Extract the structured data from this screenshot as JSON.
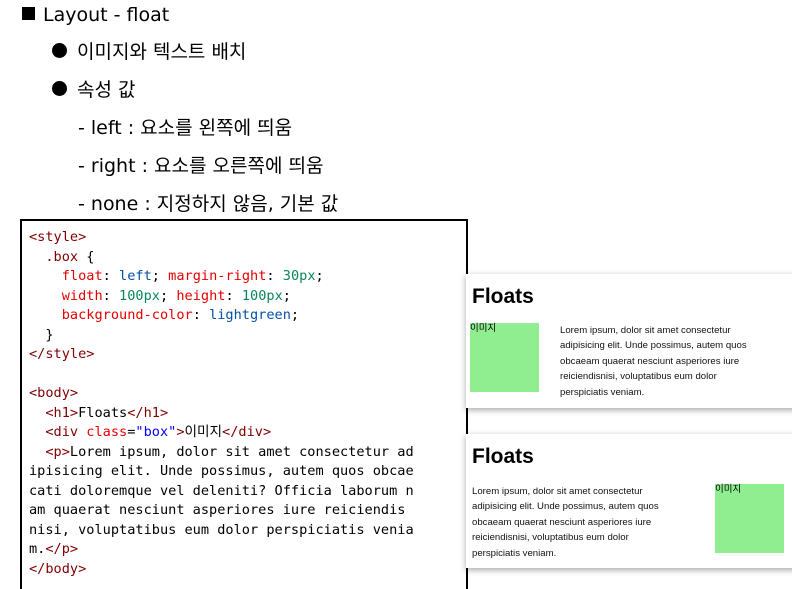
{
  "heading": "Layout - float",
  "bullets": [
    "이미지와 텍스트 배치",
    "속성 값"
  ],
  "values": [
    "- left : 요소를 왼쪽에 띄움",
    "- right : 요소를 오른쪽에 띄움",
    "- none : 지정하지 않음, 기본 값"
  ],
  "code_lines": [
    [
      {
        "c": "tag",
        "t": "<style>"
      }
    ],
    [
      {
        "c": "sel",
        "t": "  .box"
      },
      {
        "c": "txt",
        "t": " {"
      }
    ],
    [
      {
        "c": "prop",
        "t": "    float"
      },
      {
        "c": "txt",
        "t": ": "
      },
      {
        "c": "val",
        "t": "left"
      },
      {
        "c": "txt",
        "t": "; "
      },
      {
        "c": "prop",
        "t": "margin-right"
      },
      {
        "c": "txt",
        "t": ": "
      },
      {
        "c": "num",
        "t": "30px"
      },
      {
        "c": "txt",
        "t": ";"
      }
    ],
    [
      {
        "c": "prop",
        "t": "    width"
      },
      {
        "c": "txt",
        "t": ": "
      },
      {
        "c": "num",
        "t": "100px"
      },
      {
        "c": "txt",
        "t": "; "
      },
      {
        "c": "prop",
        "t": "height"
      },
      {
        "c": "txt",
        "t": ": "
      },
      {
        "c": "num",
        "t": "100px"
      },
      {
        "c": "txt",
        "t": ";"
      }
    ],
    [
      {
        "c": "prop",
        "t": "    background-color"
      },
      {
        "c": "txt",
        "t": ": "
      },
      {
        "c": "val",
        "t": "lightgreen"
      },
      {
        "c": "txt",
        "t": ";"
      }
    ],
    [
      {
        "c": "txt",
        "t": "  }"
      }
    ],
    [
      {
        "c": "tag",
        "t": "</style>"
      }
    ],
    [
      {
        "c": "txt",
        "t": ""
      }
    ],
    [
      {
        "c": "tag",
        "t": "<body>"
      }
    ],
    [
      {
        "c": "tag",
        "t": "  <h1>"
      },
      {
        "c": "txt",
        "t": "Floats"
      },
      {
        "c": "tag",
        "t": "</h1>"
      }
    ],
    [
      {
        "c": "tag",
        "t": "  <div "
      },
      {
        "c": "prop",
        "t": "class"
      },
      {
        "c": "txt",
        "t": "="
      },
      {
        "c": "str",
        "t": "\"box\""
      },
      {
        "c": "tag",
        "t": ">"
      },
      {
        "c": "txt",
        "t": "이미지"
      },
      {
        "c": "tag",
        "t": "</div>"
      }
    ],
    [
      {
        "c": "tag",
        "t": "  <p>"
      },
      {
        "c": "txt",
        "t": "Lorem ipsum, dolor sit amet consectetur ad"
      }
    ],
    [
      {
        "c": "txt",
        "t": "ipisicing elit. Unde possimus, autem quos obcae"
      }
    ],
    [
      {
        "c": "txt",
        "t": "cati doloremque vel deleniti? Officia laborum n"
      }
    ],
    [
      {
        "c": "txt",
        "t": "am quaerat nesciunt asperiores iure reiciendis"
      }
    ],
    [
      {
        "c": "txt",
        "t": "nisi, voluptatibus eum dolor perspiciatis venia"
      }
    ],
    [
      {
        "c": "txt",
        "t": "m."
      },
      {
        "c": "tag",
        "t": "</p>"
      }
    ],
    [
      {
        "c": "tag",
        "t": "</body>"
      }
    ]
  ],
  "example_left": {
    "title": "Floats",
    "box_label": "이미지",
    "lines": [
      "Lorem ipsum, dolor sit amet consectetur",
      "adipisicing elit. Unde possimus, autem quos",
      "obcaeam quaerat nesciunt asperiores iure",
      "reiciendisnisi, voluptatibus eum dolor",
      "perspiciatis veniam."
    ]
  },
  "example_right": {
    "title": "Floats",
    "box_label": "이미지",
    "lines": [
      "Lorem ipsum, dolor sit amet consectetur",
      "adipisicing elit. Unde possimus, autem quos",
      "obcaeam quaerat nesciunt asperiores iure",
      "reiciendisnisi, voluptatibus eum dolor",
      "perspiciatis veniam."
    ]
  },
  "colors": {
    "box": "#90ee90"
  }
}
